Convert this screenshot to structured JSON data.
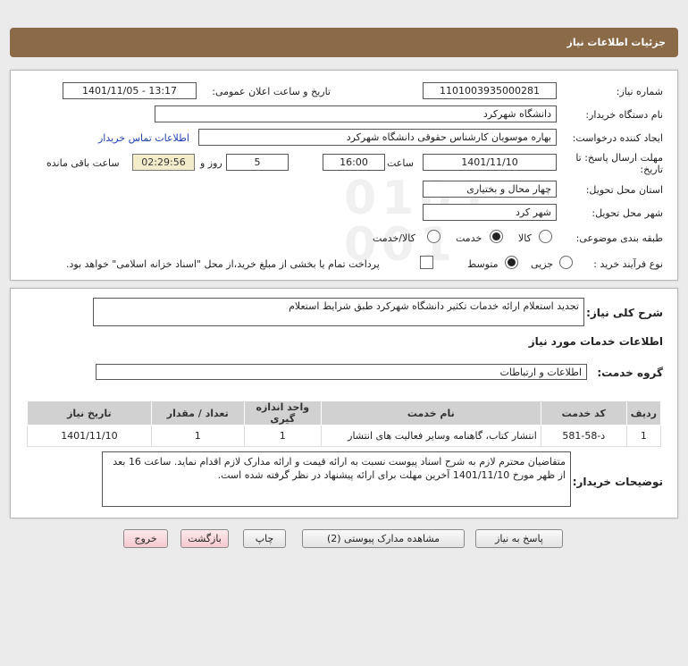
{
  "header": {
    "title": "جزئیات اطلاعات نیاز"
  },
  "form": {
    "need_number": {
      "label": "شماره نیاز:",
      "value": "1101003935000281"
    },
    "announce_datetime": {
      "label": "تاریخ و ساعت اعلان عمومی:",
      "value": "1401/11/05 - 13:17"
    },
    "buyer_org": {
      "label": "نام دستگاه خریدار:",
      "value": "دانشگاه شهرکرد"
    },
    "requester": {
      "label": "ایجاد کننده درخواست:",
      "value": "بهاره موسویان کارشناس حقوقی دانشگاه شهرکرد"
    },
    "contact_link": "اطلاعات تماس خریدار",
    "deadline": {
      "label_line1": "مهلت ارسال پاسخ: تا",
      "label_line2": "تاریخ:",
      "date": "1401/11/10",
      "time_label": "ساعت",
      "time": "16:00",
      "days": "5",
      "days_label": "روز و",
      "remaining": "02:29:56",
      "remaining_label": "ساعت باقی مانده"
    },
    "province": {
      "label": "استان محل تحویل:",
      "value": "چهار محال و بختیاری"
    },
    "city": {
      "label": "شهر محل تحویل:",
      "value": "شهر کرد"
    },
    "category": {
      "label": "طبقه بندی موضوعی:",
      "options": [
        "کالا",
        "خدمت",
        "کالا/خدمت"
      ],
      "selected": "خدمت"
    },
    "purchase_process": {
      "label": "نوع فرآیند خرید :",
      "options": [
        "جزیی",
        "متوسط"
      ],
      "selected": "متوسط",
      "treasury_note": "پرداخت تمام یا بخشی از مبلغ خرید،از محل \"اسناد خزانه اسلامی\" خواهد بود."
    }
  },
  "details": {
    "summary_label": "شرح کلی نیاز:",
    "summary_value": "تجدید استعلام ارائه خدمات تکثیر دانشگاه شهرکرد طبق شرایط استعلام",
    "services_title": "اطلاعات خدمات مورد نیاز",
    "service_group_label": "گروه خدمت:",
    "service_group_value": "اطلاعات و ارتباطات",
    "table": {
      "headers": [
        "ردیف",
        "کد خدمت",
        "نام خدمت",
        "واحد اندازه گیری",
        "تعداد / مقدار",
        "تاریخ نیاز"
      ],
      "rows": [
        [
          "1",
          "د-58-581",
          "انتشار کتاب، گاهنامه وسایر فعالیت های انتشار",
          "1",
          "1",
          "1401/11/10"
        ]
      ]
    },
    "buyer_notes_label": "توضیحات خریدار:",
    "buyer_notes_value": "متقاضیان محترم لازم به شرح اسناد پیوست نسبت به ارائه قیمت و ارائه مدارک لازم اقدام نماید. ساعت 16 بعد از ظهر مورخ 1401/11/10 آخرین مهلت برای ارائه پیشنهاد در نظر گرفته شده است."
  },
  "buttons": {
    "reply": "پاسخ به نیاز",
    "attachments": "مشاهده مدارک پیوستی (2)",
    "print": "چاپ",
    "back": "بازگشت",
    "exit": "خروج"
  },
  "watermark": {
    "text": "ParsNamadData"
  }
}
